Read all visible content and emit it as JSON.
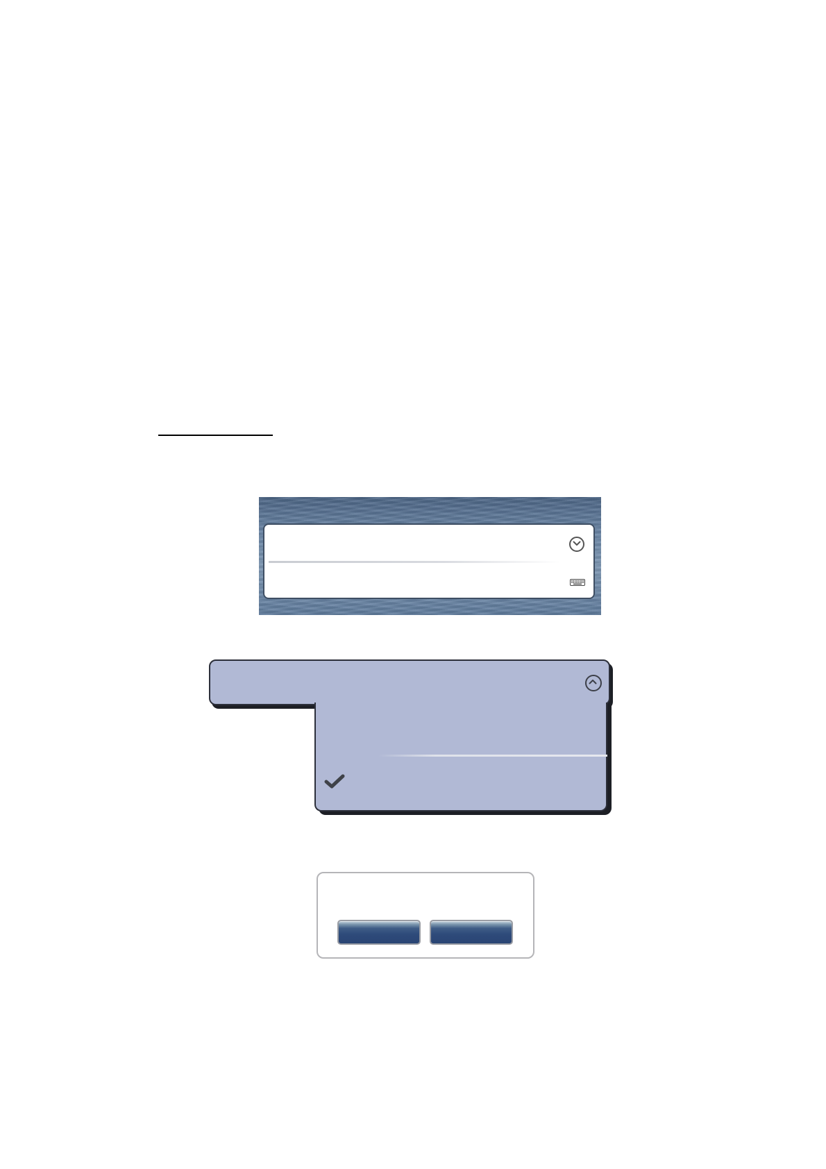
{
  "heading": {
    "text": ""
  },
  "settings_list": {
    "items": [
      {
        "label": "",
        "icon": "chevron-down-icon"
      },
      {
        "label": "",
        "icon": "keyboard-icon"
      }
    ]
  },
  "dropdown": {
    "header_label": "",
    "header_icon": "chevron-up-icon",
    "options": [
      {
        "label": "",
        "selected": false
      },
      {
        "label": "",
        "selected": true
      }
    ]
  },
  "dialog": {
    "message": "",
    "buttons": [
      {
        "label": ""
      },
      {
        "label": ""
      }
    ]
  },
  "colors": {
    "dropdown_fill": "#b1b9d5",
    "dropdown_border": "#2c2f3a",
    "button_fill": "#2e4a7a",
    "sea_background": "#6b86a6"
  }
}
